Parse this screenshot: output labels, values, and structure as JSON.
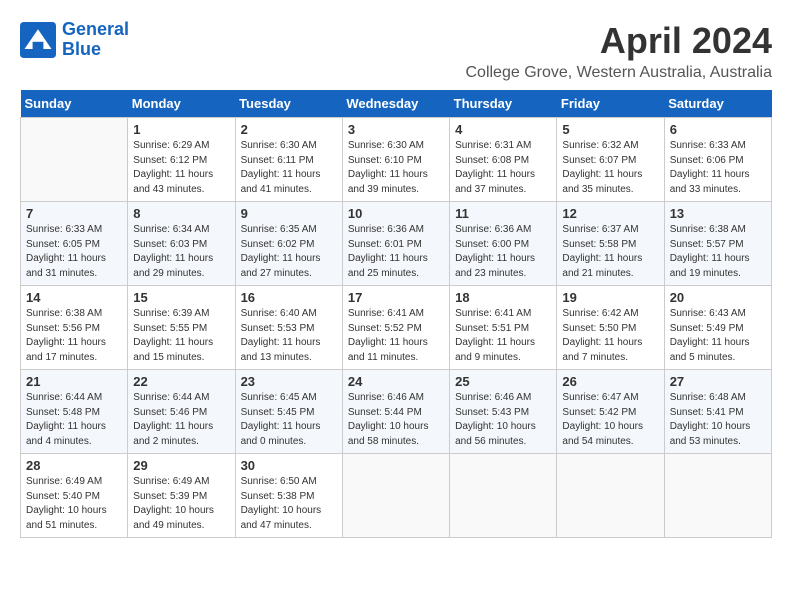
{
  "logo": {
    "line1": "General",
    "line2": "Blue"
  },
  "title": "April 2024",
  "location": "College Grove, Western Australia, Australia",
  "days_of_week": [
    "Sunday",
    "Monday",
    "Tuesday",
    "Wednesday",
    "Thursday",
    "Friday",
    "Saturday"
  ],
  "weeks": [
    [
      {
        "day": "",
        "info": ""
      },
      {
        "day": "1",
        "info": "Sunrise: 6:29 AM\nSunset: 6:12 PM\nDaylight: 11 hours\nand 43 minutes."
      },
      {
        "day": "2",
        "info": "Sunrise: 6:30 AM\nSunset: 6:11 PM\nDaylight: 11 hours\nand 41 minutes."
      },
      {
        "day": "3",
        "info": "Sunrise: 6:30 AM\nSunset: 6:10 PM\nDaylight: 11 hours\nand 39 minutes."
      },
      {
        "day": "4",
        "info": "Sunrise: 6:31 AM\nSunset: 6:08 PM\nDaylight: 11 hours\nand 37 minutes."
      },
      {
        "day": "5",
        "info": "Sunrise: 6:32 AM\nSunset: 6:07 PM\nDaylight: 11 hours\nand 35 minutes."
      },
      {
        "day": "6",
        "info": "Sunrise: 6:33 AM\nSunset: 6:06 PM\nDaylight: 11 hours\nand 33 minutes."
      }
    ],
    [
      {
        "day": "7",
        "info": "Sunrise: 6:33 AM\nSunset: 6:05 PM\nDaylight: 11 hours\nand 31 minutes."
      },
      {
        "day": "8",
        "info": "Sunrise: 6:34 AM\nSunset: 6:03 PM\nDaylight: 11 hours\nand 29 minutes."
      },
      {
        "day": "9",
        "info": "Sunrise: 6:35 AM\nSunset: 6:02 PM\nDaylight: 11 hours\nand 27 minutes."
      },
      {
        "day": "10",
        "info": "Sunrise: 6:36 AM\nSunset: 6:01 PM\nDaylight: 11 hours\nand 25 minutes."
      },
      {
        "day": "11",
        "info": "Sunrise: 6:36 AM\nSunset: 6:00 PM\nDaylight: 11 hours\nand 23 minutes."
      },
      {
        "day": "12",
        "info": "Sunrise: 6:37 AM\nSunset: 5:58 PM\nDaylight: 11 hours\nand 21 minutes."
      },
      {
        "day": "13",
        "info": "Sunrise: 6:38 AM\nSunset: 5:57 PM\nDaylight: 11 hours\nand 19 minutes."
      }
    ],
    [
      {
        "day": "14",
        "info": "Sunrise: 6:38 AM\nSunset: 5:56 PM\nDaylight: 11 hours\nand 17 minutes."
      },
      {
        "day": "15",
        "info": "Sunrise: 6:39 AM\nSunset: 5:55 PM\nDaylight: 11 hours\nand 15 minutes."
      },
      {
        "day": "16",
        "info": "Sunrise: 6:40 AM\nSunset: 5:53 PM\nDaylight: 11 hours\nand 13 minutes."
      },
      {
        "day": "17",
        "info": "Sunrise: 6:41 AM\nSunset: 5:52 PM\nDaylight: 11 hours\nand 11 minutes."
      },
      {
        "day": "18",
        "info": "Sunrise: 6:41 AM\nSunset: 5:51 PM\nDaylight: 11 hours\nand 9 minutes."
      },
      {
        "day": "19",
        "info": "Sunrise: 6:42 AM\nSunset: 5:50 PM\nDaylight: 11 hours\nand 7 minutes."
      },
      {
        "day": "20",
        "info": "Sunrise: 6:43 AM\nSunset: 5:49 PM\nDaylight: 11 hours\nand 5 minutes."
      }
    ],
    [
      {
        "day": "21",
        "info": "Sunrise: 6:44 AM\nSunset: 5:48 PM\nDaylight: 11 hours\nand 4 minutes."
      },
      {
        "day": "22",
        "info": "Sunrise: 6:44 AM\nSunset: 5:46 PM\nDaylight: 11 hours\nand 2 minutes."
      },
      {
        "day": "23",
        "info": "Sunrise: 6:45 AM\nSunset: 5:45 PM\nDaylight: 11 hours\nand 0 minutes."
      },
      {
        "day": "24",
        "info": "Sunrise: 6:46 AM\nSunset: 5:44 PM\nDaylight: 10 hours\nand 58 minutes."
      },
      {
        "day": "25",
        "info": "Sunrise: 6:46 AM\nSunset: 5:43 PM\nDaylight: 10 hours\nand 56 minutes."
      },
      {
        "day": "26",
        "info": "Sunrise: 6:47 AM\nSunset: 5:42 PM\nDaylight: 10 hours\nand 54 minutes."
      },
      {
        "day": "27",
        "info": "Sunrise: 6:48 AM\nSunset: 5:41 PM\nDaylight: 10 hours\nand 53 minutes."
      }
    ],
    [
      {
        "day": "28",
        "info": "Sunrise: 6:49 AM\nSunset: 5:40 PM\nDaylight: 10 hours\nand 51 minutes."
      },
      {
        "day": "29",
        "info": "Sunrise: 6:49 AM\nSunset: 5:39 PM\nDaylight: 10 hours\nand 49 minutes."
      },
      {
        "day": "30",
        "info": "Sunrise: 6:50 AM\nSunset: 5:38 PM\nDaylight: 10 hours\nand 47 minutes."
      },
      {
        "day": "",
        "info": ""
      },
      {
        "day": "",
        "info": ""
      },
      {
        "day": "",
        "info": ""
      },
      {
        "day": "",
        "info": ""
      }
    ]
  ]
}
